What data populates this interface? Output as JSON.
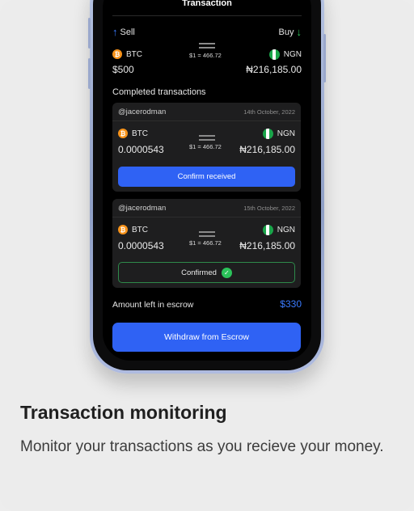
{
  "header": {
    "title": "Transaction"
  },
  "summary": {
    "sell_label": "Sell",
    "buy_label": "Buy",
    "from_currency": "BTC",
    "to_currency": "NGN",
    "from_amount": "$500",
    "to_amount": "₦216,185.00",
    "rate": "$1 = 466.72"
  },
  "section": {
    "completed_title": "Completed transactions"
  },
  "transactions": [
    {
      "user": "@jacerodman",
      "date": "14th October, 2022",
      "from_currency": "BTC",
      "from_amount": "0.0000543",
      "rate": "$1 = 466.72",
      "to_currency": "NGN",
      "to_amount": "₦216,185.00",
      "action_label": "Confirm received"
    },
    {
      "user": "@jacerodman",
      "date": "15th October, 2022",
      "from_currency": "BTC",
      "from_amount": "0.0000543",
      "rate": "$1 = 466.72",
      "to_currency": "NGN",
      "to_amount": "₦216,185.00",
      "status_label": "Confirmed"
    }
  ],
  "escrow": {
    "label": "Amount left in escrow",
    "value": "$330"
  },
  "withdraw": {
    "label": "Withdraw from Escrow"
  },
  "caption": {
    "title": "Transaction monitoring",
    "body": "Monitor your transactions as you recieve your money."
  },
  "icons": {
    "sell": "arrow-up-icon",
    "buy": "arrow-down-icon",
    "btc": "bitcoin-icon",
    "ngn": "nigeria-flag-icon",
    "swap": "swap-arrows-icon",
    "confirmed": "check-circle-icon"
  },
  "colors": {
    "accent_blue": "#2f62f4",
    "success_green": "#2bc25a",
    "btc_orange": "#f7931a",
    "screen_bg": "#000000",
    "card_bg": "#1e1e1f"
  }
}
